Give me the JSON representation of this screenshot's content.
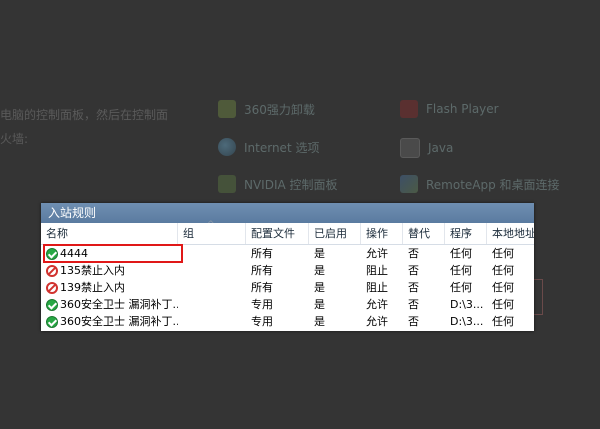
{
  "background": {
    "left_text_1": "电脑的控制面板，然后在控制面",
    "left_text_2": "火墙:",
    "items": [
      {
        "label": "360强力卸载",
        "icon": "power-icon"
      },
      {
        "label": "Flash Player",
        "icon": "flash-icon"
      },
      {
        "label": "Internet 选项",
        "icon": "globe-icon"
      },
      {
        "label": "Java",
        "icon": "java-icon"
      },
      {
        "label": "NVIDIA 控制面板",
        "icon": "nvidia-icon"
      },
      {
        "label": "RemoteApp 和桌面连接",
        "icon": "remote-desktop-icon"
      }
    ]
  },
  "window": {
    "title": "入站规则",
    "columns": [
      "名称",
      "组",
      "配置文件",
      "已启用",
      "操作",
      "替代",
      "程序",
      "本地地址"
    ],
    "rows": [
      {
        "status": "allow",
        "name": "4444",
        "group": "",
        "profile": "所有",
        "enabled": "是",
        "action": "允许",
        "override": "否",
        "program": "任何",
        "local": "任何"
      },
      {
        "status": "block",
        "name": "135禁止入内",
        "group": "",
        "profile": "所有",
        "enabled": "是",
        "action": "阻止",
        "override": "否",
        "program": "任何",
        "local": "任何"
      },
      {
        "status": "block",
        "name": "139禁止入内",
        "group": "",
        "profile": "所有",
        "enabled": "是",
        "action": "阻止",
        "override": "否",
        "program": "任何",
        "local": "任何"
      },
      {
        "status": "allow",
        "name": "360安全卫士 漏洞补丁...",
        "group": "",
        "profile": "专用",
        "enabled": "是",
        "action": "允许",
        "override": "否",
        "program": "D:\\3...",
        "local": "任何"
      },
      {
        "status": "allow",
        "name": "360安全卫士 漏洞补丁...",
        "group": "",
        "profile": "专用",
        "enabled": "是",
        "action": "允许",
        "override": "否",
        "program": "D:\\3...",
        "local": "任何"
      }
    ]
  },
  "colors": {
    "title_bar": "#5a7ba0",
    "highlight": "#e01818",
    "allow": "#27a844",
    "block": "#d1322f"
  }
}
